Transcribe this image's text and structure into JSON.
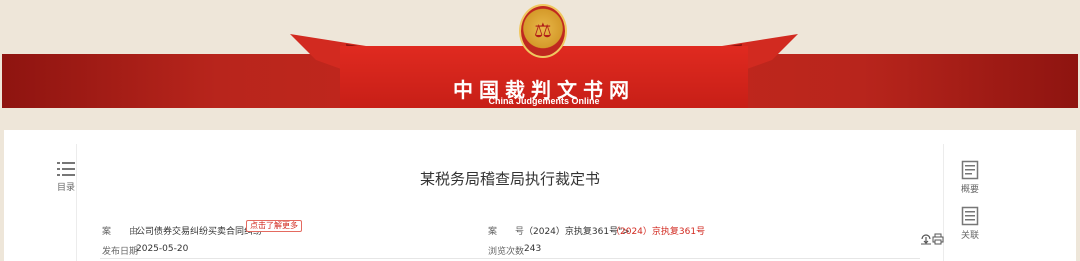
{
  "header": {
    "site_title": "中国裁判文书网",
    "site_subtitle": "China Judgements Online",
    "colors": {
      "band": "#c8281e",
      "panel": "#e02a20",
      "emblem_gold": "#d59a2a"
    }
  },
  "sidebar_left": {
    "toc_label": "目录"
  },
  "sidebar_right": {
    "overview_label": "概要",
    "related_label": "关联"
  },
  "document": {
    "title": "某税务局稽查局执行裁定书",
    "cause_label": "案　　由",
    "cause_value": "公司债券交易纠纷买卖合同纠纷",
    "learn_more": "点击了解更多",
    "case_no_label": "案　　号",
    "case_no_prefix": "（2024）京执复361号\">",
    "case_no_value": "（2024）京执复361号",
    "publish_date_label": "发布日期",
    "publish_date_value": "2025-05-20",
    "views_label": "浏览次数",
    "views_value": "243"
  }
}
